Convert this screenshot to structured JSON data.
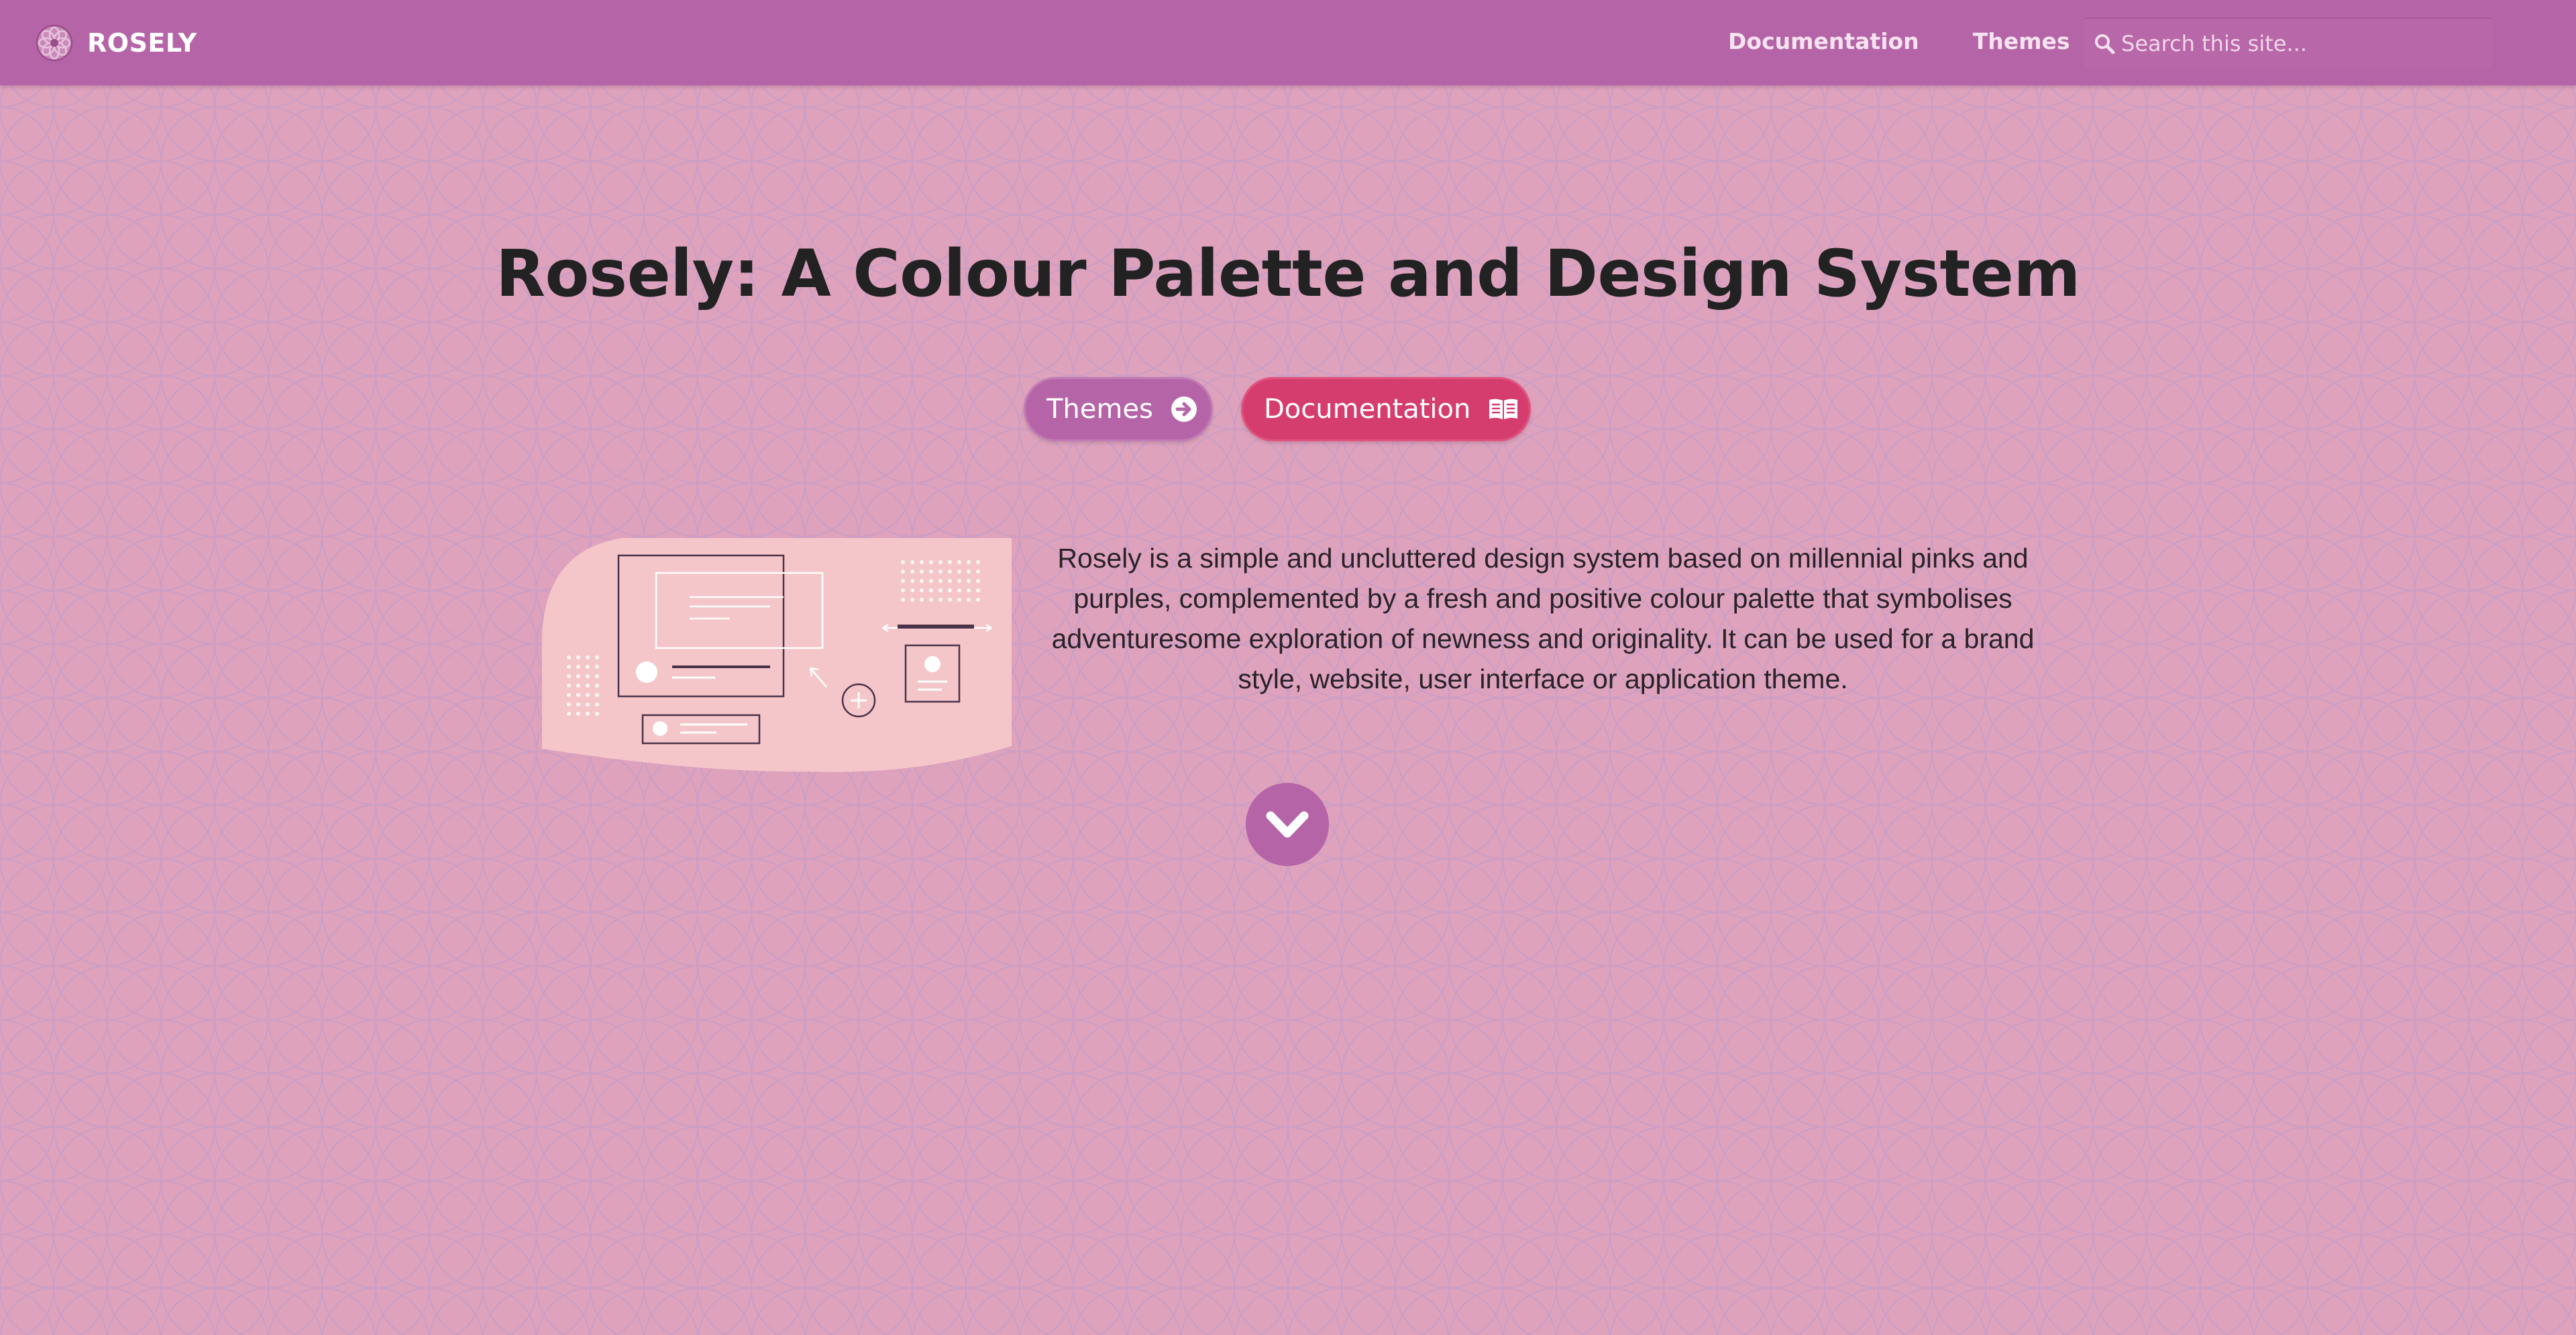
{
  "navbar": {
    "brand_name": "ROSELY",
    "logo_icon": "rosely-flower-logo",
    "links": [
      "Documentation",
      "Themes"
    ],
    "search": {
      "placeholder": "Search this site...",
      "value": "",
      "icon": "search-icon"
    }
  },
  "hero": {
    "title": "Rosely: A Colour Palette and Design System",
    "buttons": {
      "themes": {
        "label": "Themes",
        "icon": "arrow-right-circle-icon"
      },
      "documentation": {
        "label": "Documentation",
        "icon": "open-book-icon"
      }
    },
    "description": "Rosely is a simple and uncluttered design system based on millennial pinks and purples, complemented by a fresh and positive colour palette that symbolises adventuresome exploration of newness and originality. It can be used for a brand style, website, user interface or application theme.",
    "scroll_icon": "chevron-down-icon"
  },
  "colors": {
    "navbar": "#b565a7",
    "background": "#dea2bd",
    "pattern_line": "#c79cc6",
    "button_themes": "#b565a7",
    "button_docs": "#d63d6f",
    "illustration_fill": "#f5c6c9",
    "title_text": "#222222"
  }
}
